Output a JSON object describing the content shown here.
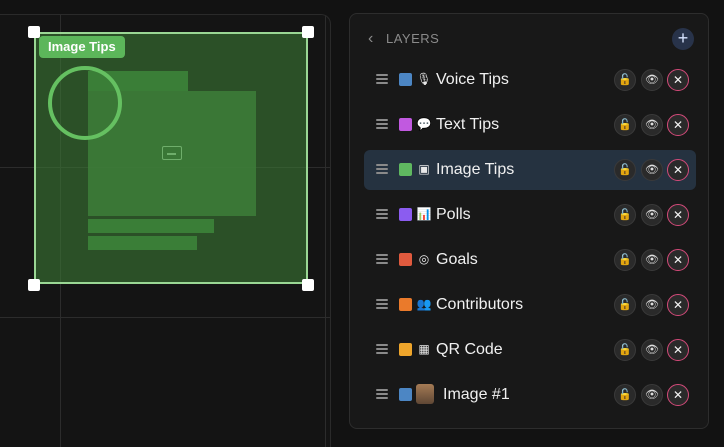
{
  "canvas": {
    "selection_label": "Image Tips"
  },
  "layers_panel": {
    "title": "LAYERS",
    "add_label": "+",
    "items": [
      {
        "label": "Voice Tips",
        "color": "#4c86c4",
        "icon": "microphone-icon",
        "glyph": "🎙",
        "active": false
      },
      {
        "label": "Text Tips",
        "color": "#c159e0",
        "icon": "speech-bubble-icon",
        "glyph": "💬",
        "active": false
      },
      {
        "label": "Image Tips",
        "color": "#5fb860",
        "icon": "image-icon",
        "glyph": "▣",
        "active": true
      },
      {
        "label": "Polls",
        "color": "#8b5cf0",
        "icon": "bar-chart-icon",
        "glyph": "📊",
        "active": false
      },
      {
        "label": "Goals",
        "color": "#e05a3e",
        "icon": "target-icon",
        "glyph": "◎",
        "active": false
      },
      {
        "label": "Contributors",
        "color": "#ea7a2b",
        "icon": "people-icon",
        "glyph": "👥",
        "active": false
      },
      {
        "label": "QR Code",
        "color": "#eea52b",
        "icon": "qr-code-icon",
        "glyph": "▦",
        "active": false
      },
      {
        "label": "Image #1",
        "color": "#4c86c4",
        "icon": "avatar",
        "glyph": "",
        "active": false
      }
    ],
    "actions": {
      "lock": "🔓",
      "eye": "👁",
      "delete": "✕"
    }
  }
}
